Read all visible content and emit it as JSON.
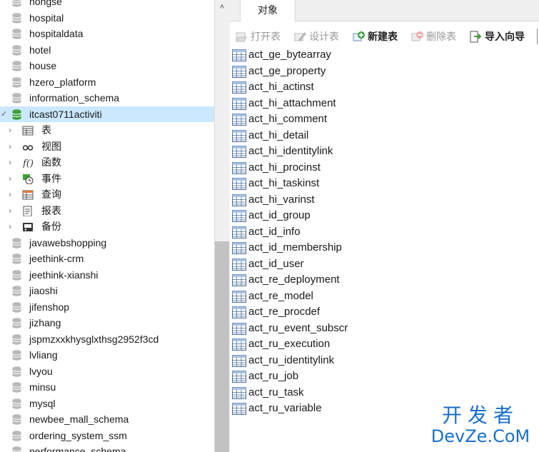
{
  "tree": {
    "databases_before": [
      "hongse",
      "hospital",
      "hospitaldata",
      "hotel",
      "house",
      "hzero_platform",
      "information_schema"
    ],
    "selected_database": "itcast0711activiti",
    "children": [
      {
        "label": "表",
        "icon": "table-icon"
      },
      {
        "label": "视图",
        "icon": "view-icon"
      },
      {
        "label": "函数",
        "icon": "function-icon"
      },
      {
        "label": "事件",
        "icon": "event-icon"
      },
      {
        "label": "查询",
        "icon": "query-icon"
      },
      {
        "label": "报表",
        "icon": "report-icon"
      },
      {
        "label": "备份",
        "icon": "backup-icon"
      }
    ],
    "databases_after": [
      "javawebshopping",
      "jeethink-crm",
      "jeethink-xianshi",
      "jiaoshi",
      "jifenshop",
      "jizhang",
      "jspmzxxkhysglxthsg2952f3cd",
      "lvliang",
      "lvyou",
      "minsu",
      "mysql",
      "newbee_mall_schema",
      "ordering_system_ssm",
      "performance_schema"
    ]
  },
  "tabs": {
    "objects": "对象"
  },
  "toolbar": {
    "open_table": "打开表",
    "design_table": "设计表",
    "new_table": "新建表",
    "delete_table": "删除表",
    "import_wizard": "导入向导"
  },
  "tables": [
    "act_ge_bytearray",
    "act_ge_property",
    "act_hi_actinst",
    "act_hi_attachment",
    "act_hi_comment",
    "act_hi_detail",
    "act_hi_identitylink",
    "act_hi_procinst",
    "act_hi_taskinst",
    "act_hi_varinst",
    "act_id_group",
    "act_id_info",
    "act_id_membership",
    "act_id_user",
    "act_re_deployment",
    "act_re_model",
    "act_re_procdef",
    "act_ru_event_subscr",
    "act_ru_execution",
    "act_ru_identitylink",
    "act_ru_job",
    "act_ru_task",
    "act_ru_variable"
  ],
  "watermark": {
    "top": "开发者",
    "bottom": "DevZe.CoM"
  },
  "colors": {
    "selection": "#cce8ff",
    "db_green": "#3aa23a",
    "watermark": "#1a6fc8"
  }
}
